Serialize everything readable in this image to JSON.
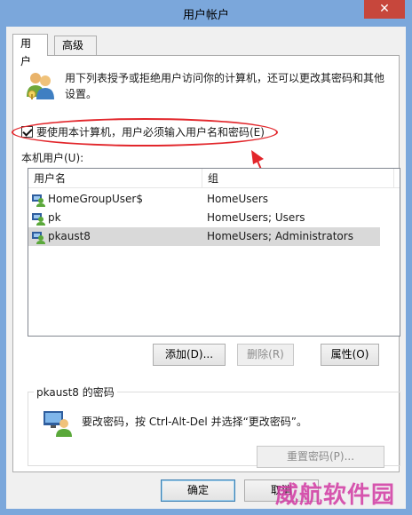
{
  "window": {
    "title": "用户帐户",
    "close_glyph": "✕"
  },
  "tabs": [
    {
      "label": "用户",
      "active": true
    },
    {
      "label": "高级",
      "active": false
    }
  ],
  "intro_text": "用下列表授予或拒绝用户访问你的计算机，还可以更改其密码和其他设置。",
  "require_login": {
    "label": "要使用本计算机，用户必须输入用户名和密码(E)",
    "checked": true
  },
  "local_users_label": "本机用户(U):",
  "users_table": {
    "columns": [
      "用户名",
      "组"
    ],
    "rows": [
      {
        "name": "HomeGroupUser$",
        "group": "HomeUsers",
        "selected": false
      },
      {
        "name": "pk",
        "group": "HomeUsers; Users",
        "selected": false
      },
      {
        "name": "pkaust8",
        "group": "HomeUsers; Administrators",
        "selected": true
      }
    ]
  },
  "buttons": {
    "add": "添加(D)...",
    "delete": "删除(R)",
    "properties": "属性(O)",
    "reset_password": "重置密码(P)...",
    "ok": "确定",
    "cancel": "取消"
  },
  "password_group": {
    "title": "pkaust8 的密码",
    "text": "要改密码，按 Ctrl-Alt-Del 并选择“更改密码”。"
  },
  "watermark": "威航软件园",
  "colors": {
    "annotation": "#e2262b",
    "titlebar": "#7ba7db",
    "close": "#c7473c",
    "watermark": "#d23aa3"
  }
}
